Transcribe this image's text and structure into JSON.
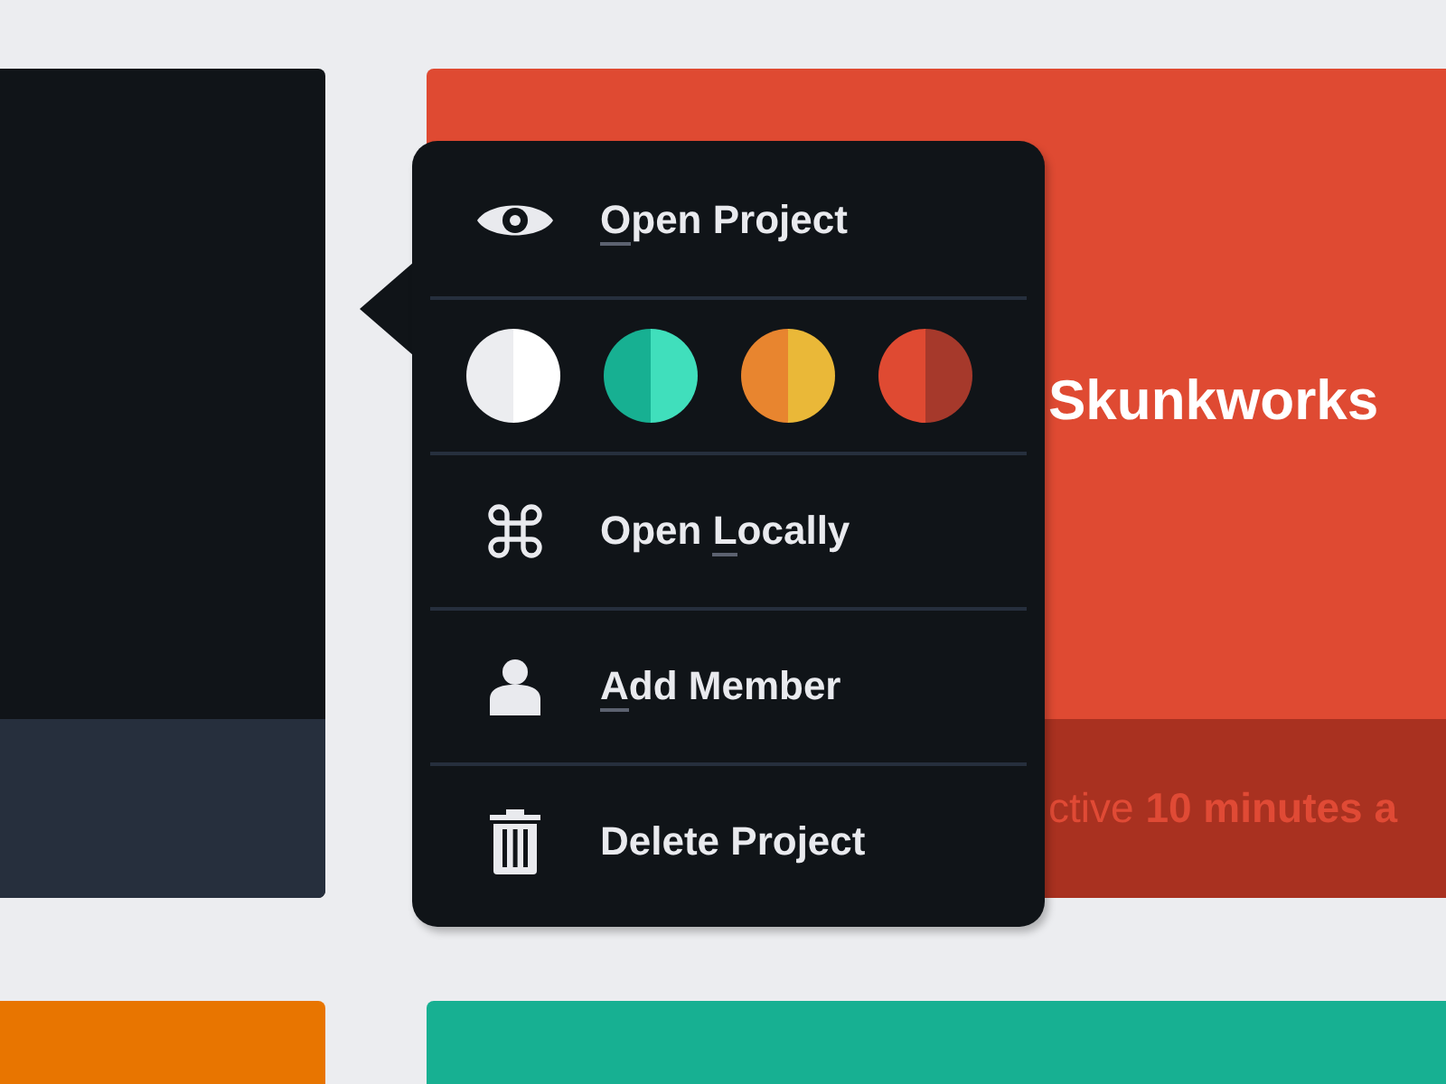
{
  "cards": [
    {
      "kind": "dark"
    },
    {
      "kind": "red",
      "title": "Skunkworks",
      "footer": "ctive **10 minutes a**"
    },
    {
      "kind": "orange"
    },
    {
      "kind": "teal"
    }
  ],
  "menu": {
    "items": [
      {
        "kind": "action",
        "access_key": "O",
        "rest": "pen Project"
      },
      {
        "kind": "colors",
        "swatches": [
          {
            "halves": [
              {
                "color": "#ecedf0"
              },
              {
                "color": "#ffffff"
              }
            ]
          },
          {
            "halves": [
              {
                "color": "#17b092"
              },
              {
                "color": "#40dfbc"
              }
            ]
          },
          {
            "halves": [
              {
                "color": "#e8852f"
              },
              {
                "color": "#eab838"
              }
            ]
          },
          {
            "halves": [
              {
                "color": "#df4a32"
              },
              {
                "color": "#a6392b"
              }
            ]
          }
        ]
      },
      {
        "kind": "action",
        "prefix": "Open ",
        "access_key": "L",
        "rest": "ocally"
      },
      {
        "kind": "action",
        "access_key": "A",
        "rest": "dd Member"
      },
      {
        "kind": "action",
        "prefix": "Delete Project"
      }
    ]
  }
}
